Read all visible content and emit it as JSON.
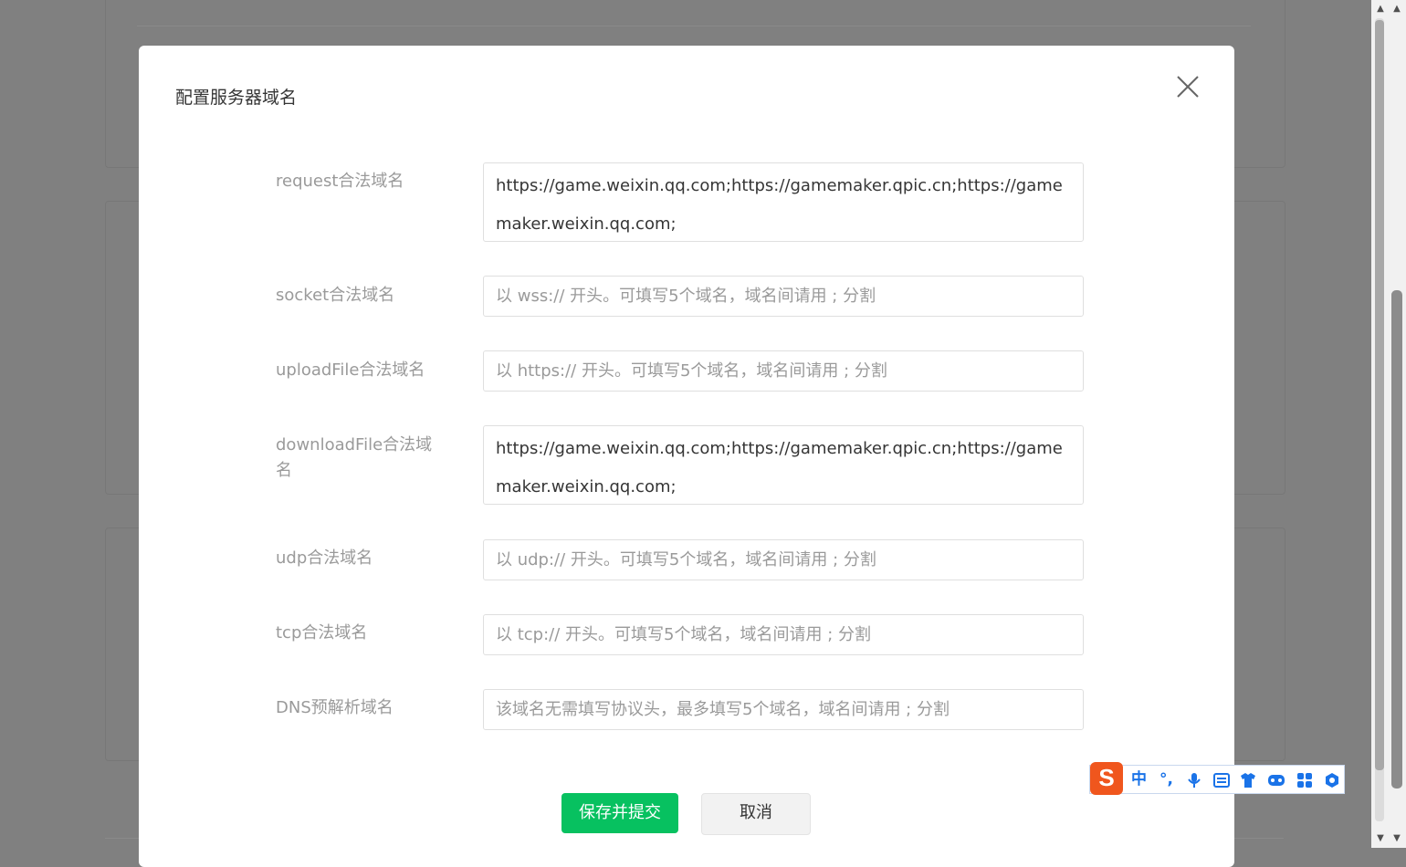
{
  "dialog": {
    "title": "配置服务器域名",
    "fields": [
      {
        "label": "request合法域名",
        "value": "https://game.weixin.qq.com;https://gamemaker.qpic.cn;https://gamemaker.weixin.qq.com;"
      },
      {
        "label": "socket合法域名",
        "placeholder": "以 wss:// 开头。可填写5个域名，域名间请用 ; 分割"
      },
      {
        "label": "uploadFile合法域名",
        "placeholder": "以 https:// 开头。可填写5个域名，域名间请用 ; 分割"
      },
      {
        "label": "downloadFile合法域名",
        "value": "https://game.weixin.qq.com;https://gamemaker.qpic.cn;https://gamemaker.weixin.qq.com;"
      },
      {
        "label": "udp合法域名",
        "placeholder": "以 udp:// 开头。可填写5个域名，域名间请用 ; 分割"
      },
      {
        "label": "tcp合法域名",
        "placeholder": "以 tcp:// 开头。可填写5个域名，域名间请用 ; 分割"
      },
      {
        "label": "DNS预解析域名",
        "placeholder": "该域名无需填写协议头，最多填写5个域名，域名间请用 ; 分割"
      }
    ],
    "save_label": "保存并提交",
    "cancel_label": "取消"
  },
  "ime": {
    "logo": "S",
    "mode": "中",
    "punct": "°,",
    "icons": [
      "microphone-icon",
      "keyboard-icon",
      "skin-icon",
      "gamepad-icon",
      "apps-icon",
      "settings-icon"
    ]
  },
  "colors": {
    "primary": "#07c160",
    "overlay": "#808080",
    "ime_logo": "#f0561d"
  }
}
